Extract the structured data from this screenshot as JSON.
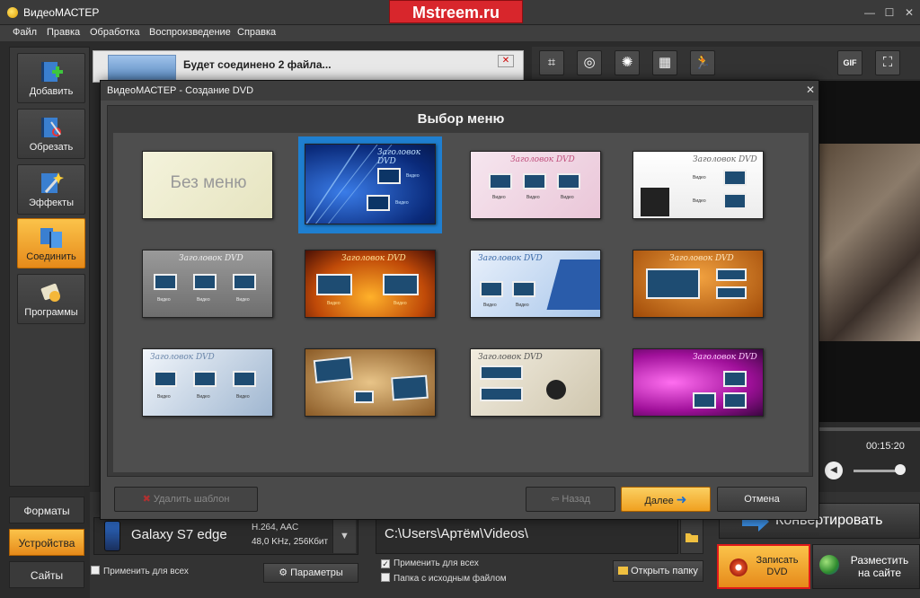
{
  "app": {
    "title": "ВидеоМАСТЕР",
    "watermark": "Mstreem.ru",
    "window_controls": {
      "minimize": "—",
      "maximize": "☐",
      "close": "✕"
    }
  },
  "menu": [
    "Файл",
    "Правка",
    "Обработка",
    "Воспроизведение",
    "Справка"
  ],
  "sidebar": {
    "items": [
      {
        "label": "Добавить",
        "icon": "add-film-icon"
      },
      {
        "label": "Обрезать",
        "icon": "cut-film-icon"
      },
      {
        "label": "Эффекты",
        "icon": "effects-wand-icon"
      },
      {
        "label": "Соединить",
        "icon": "join-film-icon",
        "active": true
      },
      {
        "label": "Программы",
        "icon": "programs-icon"
      }
    ]
  },
  "bottom_tabs": [
    {
      "label": "Форматы"
    },
    {
      "label": "Устройства",
      "active": true
    },
    {
      "label": "Сайты"
    }
  ],
  "file_list": {
    "info": "Будет соединено 2 файла...",
    "close": "✕"
  },
  "right_toolbar": {
    "tools": [
      {
        "icon": "crop-icon",
        "glyph": "⌗"
      },
      {
        "icon": "stabilize-icon",
        "glyph": "◎"
      },
      {
        "icon": "brightness-icon",
        "glyph": "✺"
      },
      {
        "icon": "film-speed-icon",
        "glyph": "▦"
      },
      {
        "icon": "running-man-icon",
        "glyph": "🏃"
      },
      {
        "icon": "gif-icon",
        "glyph": "GIF"
      },
      {
        "icon": "fullscreen-icon",
        "glyph": "⛶"
      }
    ]
  },
  "player": {
    "timecode": "00:15:20"
  },
  "device": {
    "name": "Galaxy S7 edge",
    "specs_line1": "H.264, AAC",
    "specs_line2": "48,0 KHz, 256Кбит",
    "dropdown_glyph": "▼",
    "apply_all": "Применить для всех",
    "params_label": "Параметры",
    "params_glyph": "⚙"
  },
  "output": {
    "path": "C:\\Users\\Артём\\Videos\\",
    "apply_all": "Применить для всех",
    "same_folder": "Папка с исходным файлом",
    "open_folder": "Открыть папку",
    "check_mark": "✓"
  },
  "actions": {
    "convert": "Конвертировать",
    "burn_dvd_line1": "Записать",
    "burn_dvd_line2": "DVD",
    "publish_line1": "Разместить",
    "publish_line2": "на сайте"
  },
  "dialog": {
    "title": "ВидеоМАСТЕР - Создание DVD",
    "close": "✕",
    "heading": "Выбор меню",
    "templates": {
      "no_menu_label": "Без меню",
      "title_text": "Заголовок DVD",
      "caption": "Видео"
    },
    "buttons": {
      "delete": "Удалить шаблон",
      "back": "Назад",
      "next": "Далее",
      "cancel": "Отмена"
    },
    "button_glyphs": {
      "delete": "✖",
      "back": "⇦",
      "next": "➜"
    }
  },
  "colors": {
    "accent_orange": "#f0a020",
    "selection_blue": "#1f7fd0",
    "highlight_red": "#e01a1a"
  }
}
